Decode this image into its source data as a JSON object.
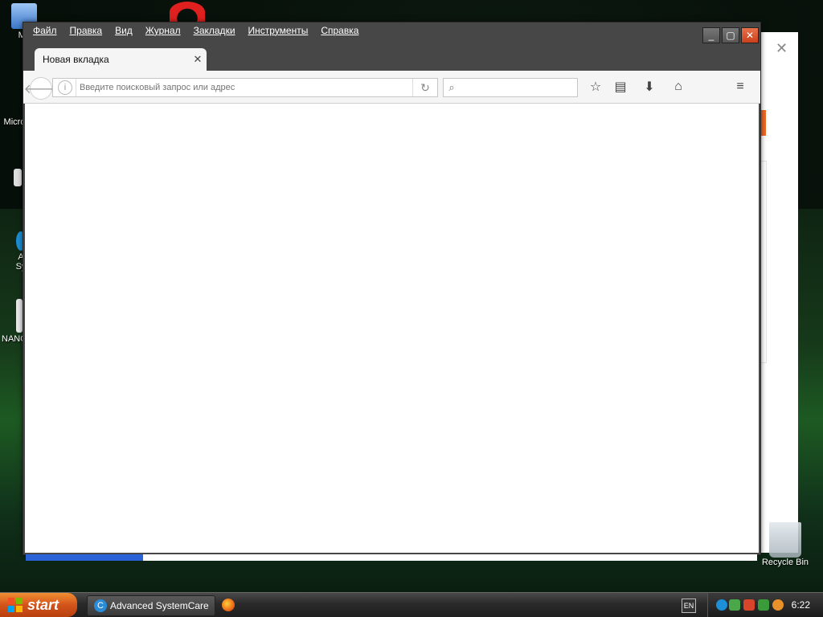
{
  "browser": {
    "menu": [
      "Файл",
      "Правка",
      "Вид",
      "Журнал",
      "Закладки",
      "Инструменты",
      "Справка"
    ],
    "tab": {
      "title": "Новая вкладка"
    },
    "url": {
      "placeholder": "Введите поисковый запрос или адрес",
      "value": ""
    },
    "search": {
      "placeholder": ""
    },
    "icons": {
      "back": "back-arrow-icon",
      "info": "info-icon",
      "reload": "reload-icon",
      "search": "search-icon",
      "bookmark": "star-icon",
      "reading_list": "clipboard-icon",
      "downloads": "download-icon",
      "home": "home-icon",
      "menu": "hamburger-menu-icon"
    },
    "page_load_progress": 0.16
  },
  "desktop": {
    "icons": [
      {
        "label": "My"
      },
      {
        "label": "Micro"
      },
      {
        "label": "A"
      },
      {
        "label": "Sy"
      },
      {
        "label": "NANO"
      }
    ],
    "recycle_bin": "Recycle Bin"
  },
  "taskbar": {
    "start": "start",
    "task": "Advanced SystemCare",
    "lang": "EN",
    "clock": "6:22"
  },
  "colors": {
    "accent_progress": "#2a63d8",
    "start_button": "#d3541b",
    "close_button": "#c9401c"
  }
}
